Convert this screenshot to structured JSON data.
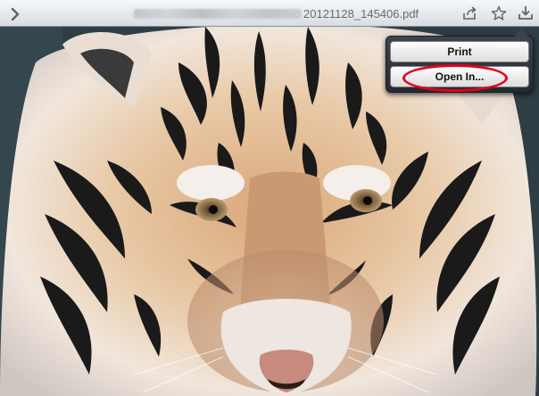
{
  "toolbar": {
    "back_icon": "chevron-right-icon",
    "title": "20121128_145406.pdf",
    "share_icon": "share-icon",
    "bookmark_icon": "star-icon",
    "save_icon": "download-tray-icon"
  },
  "popover": {
    "items": [
      {
        "label": "Print"
      },
      {
        "label": "Open In..."
      }
    ],
    "highlight_color": "#e4001b"
  },
  "document": {
    "content": "photo of tiger face"
  }
}
